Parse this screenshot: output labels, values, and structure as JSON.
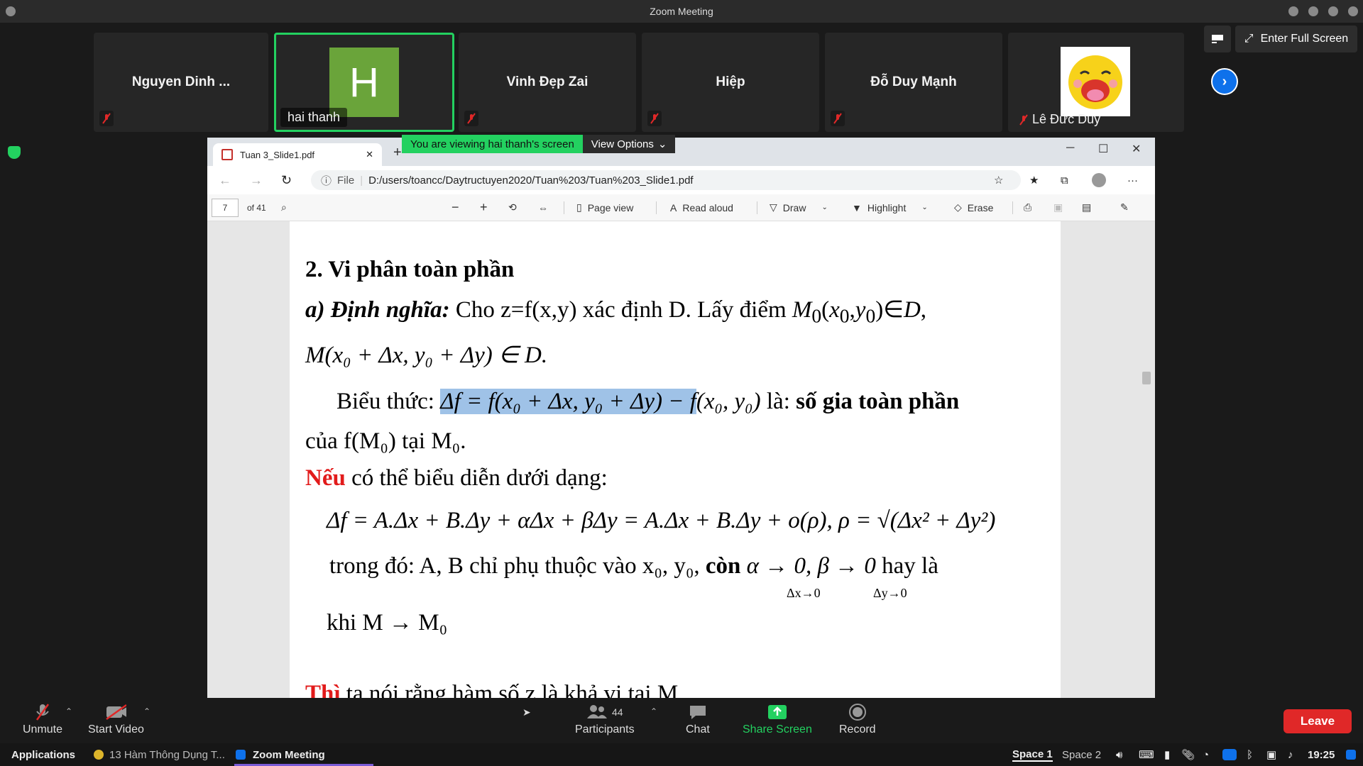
{
  "window": {
    "title": "Zoom Meeting"
  },
  "participants_strip": [
    {
      "name": "Nguyen Dinh ...",
      "muted": true
    },
    {
      "name": "hai thanh",
      "avatar_letter": "H",
      "active": true
    },
    {
      "name": "Vinh Đẹp Zai",
      "muted": true
    },
    {
      "name": "Hiệp",
      "muted": true
    },
    {
      "name": "Đỗ Duy Mạnh",
      "muted": true
    },
    {
      "name": "Lê Đức Duy",
      "muted": true
    }
  ],
  "header_controls": {
    "fullscreen_label": "Enter Full Screen"
  },
  "share_banner": {
    "viewing_text": "You are viewing hai thanh's screen",
    "view_options_label": "View Options"
  },
  "browser": {
    "tab_title": "Tuan 3_Slide1.pdf",
    "address_prefix": "File",
    "address_url": "D:/users/toancc/Daytructuyen2020/Tuan%203/Tuan%203_Slide1.pdf",
    "page_number": "7",
    "page_total": "of 41",
    "tools": {
      "page_view": "Page view",
      "read_aloud": "Read aloud",
      "draw": "Draw",
      "highlight": "Highlight",
      "erase": "Erase"
    }
  },
  "slide": {
    "heading": "2. Vi phân toàn phần",
    "def_label": "a) Định nghĩa:",
    "def_text": "Cho z=f(x,y) xác định D. Lấy điểm",
    "line2": "M(x₀ + Δx, y₀ + Δy) ∈ D.",
    "bieuthuc": "Biểu thức:",
    "bieuthuc_formula": "Δf = f(x₀ + Δx, y₀ + Δy) − f",
    "bieuthuc_tail": "(x₀, y₀)",
    "bieuthuc_la": "là:",
    "bieuthuc_bold": "số gia toàn phần",
    "cua_line": "của f(M₀) tại M₀.",
    "neu": "Nếu",
    "neu_rest": "có thể biểu diễn dưới dạng:",
    "formula": "Δf = A.Δx + B.Δy + αΔx + βΔy = A.Δx + B.Δy + o(ρ),  ρ = √(Δx² + Δy²)",
    "trong_do": "trong đó: A, B chỉ phụ thuộc vào x₀, y₀,",
    "con": "còn",
    "limits": "α → 0, β → 0",
    "hayla": "hay là",
    "sub1": "Δx→0",
    "sub2": "Δy→0",
    "khi": "khi M → M₀",
    "thi": "Thì",
    "thi_rest": "ta nói rằng hàm số z là khả vi tại M"
  },
  "toolbar": {
    "unmute": "Unmute",
    "start_video": "Start Video",
    "participants": "Participants",
    "participants_count": "44",
    "chat": "Chat",
    "share_screen": "Share Screen",
    "record": "Record",
    "leave": "Leave"
  },
  "taskbar": {
    "applications": "Applications",
    "item1": "13 Hàm Thông Dụng T...",
    "item2": "Zoom Meeting",
    "space1": "Space 1",
    "space2": "Space 2",
    "clock": "19:25"
  },
  "colors": {
    "zoom_green": "#23d160",
    "zoom_blue": "#0e71eb",
    "leave_red": "#e02828",
    "slide_red": "#e21b1b",
    "highlight": "#9fc2e7"
  }
}
